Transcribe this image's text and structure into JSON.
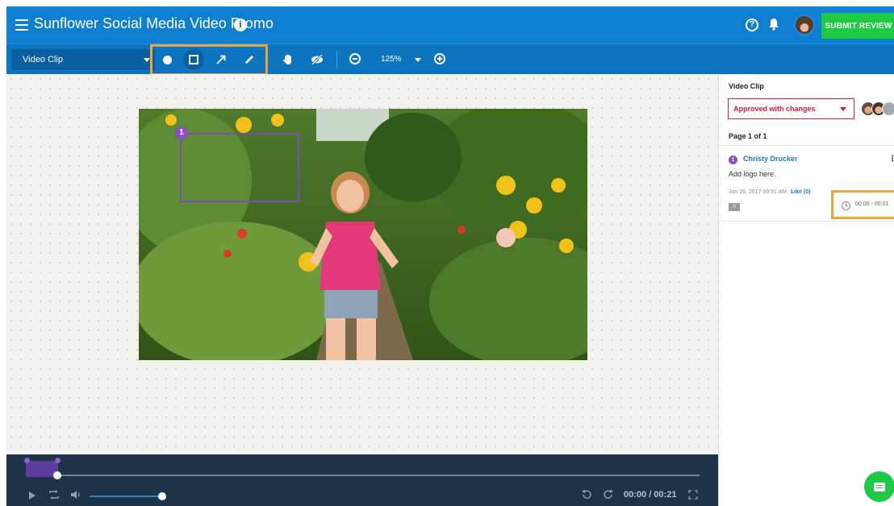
{
  "header": {
    "title": "Sunflower Social Media Video Promo",
    "submit_label": "SUBMIT REVIEW",
    "brand_color": "#0f7fd2",
    "submit_color": "#1ec943"
  },
  "toolbar": {
    "clip_select_value": "Video Clip",
    "tools": [
      "circle-tool",
      "rectangle-tool",
      "arrow-tool",
      "pen-tool"
    ],
    "active_tool": "rectangle-tool",
    "zoom": "125%",
    "highlight_color": "#f0a23b"
  },
  "canvas": {
    "annotation_number": "1",
    "annotation_color": "#8d4fc7"
  },
  "player": {
    "time": "00:00 / 00:21"
  },
  "panel": {
    "title": "Video Clip",
    "status": "Approved with changes",
    "status_color": "#c81e3a",
    "page_label": "Page 1 of 1",
    "comment": {
      "number": "1",
      "author": "Christy Drucker",
      "text": "Add logo here.",
      "date": "Jun 26, 2017 09:51 AM",
      "like": "Like (0)",
      "replies": "0",
      "time_range": "00:00 - 00:01"
    }
  }
}
